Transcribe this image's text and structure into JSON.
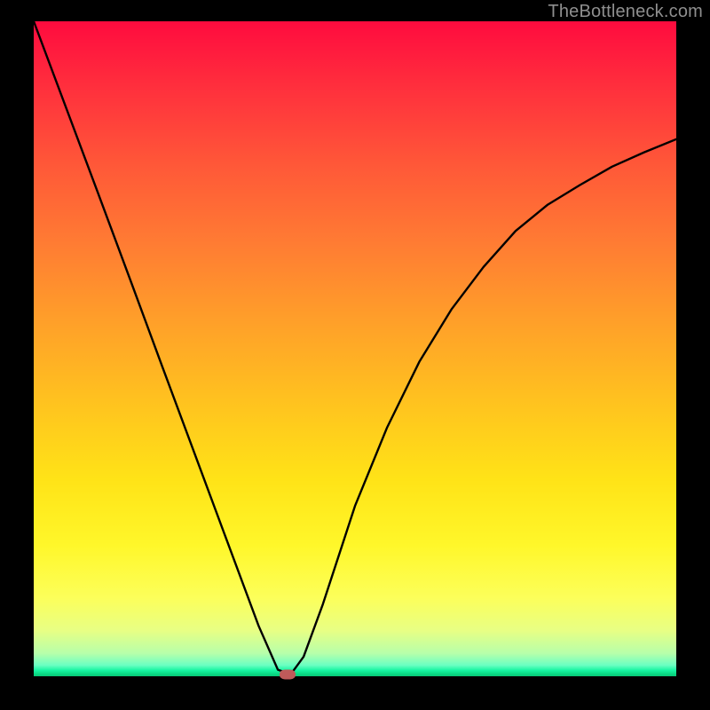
{
  "watermark": "TheBottleneck.com",
  "chart_data": {
    "type": "line",
    "title": "",
    "xlabel": "",
    "ylabel": "",
    "xlim": [
      0,
      1
    ],
    "ylim": [
      0,
      1
    ],
    "grid": false,
    "legend": false,
    "series": [
      {
        "name": "curve",
        "color": "#000000",
        "x": [
          0.0,
          0.05,
          0.1,
          0.15,
          0.2,
          0.25,
          0.3,
          0.35,
          0.38,
          0.4,
          0.42,
          0.45,
          0.5,
          0.55,
          0.6,
          0.65,
          0.7,
          0.75,
          0.8,
          0.85,
          0.9,
          0.95,
          1.0
        ],
        "y": [
          1.0,
          0.869,
          0.738,
          0.606,
          0.473,
          0.341,
          0.209,
          0.077,
          0.01,
          0.003,
          0.03,
          0.11,
          0.26,
          0.38,
          0.48,
          0.56,
          0.625,
          0.68,
          0.72,
          0.75,
          0.778,
          0.8,
          0.82
        ],
        "note": "y is fraction of plot height from bottom; values read from gradient and curve shape"
      }
    ],
    "marker": {
      "x": 0.395,
      "y": 0.0
    }
  },
  "colors": {
    "background": "#000000",
    "curve": "#000000",
    "marker": "#bf5a5a",
    "watermark": "#8f8f8f"
  }
}
